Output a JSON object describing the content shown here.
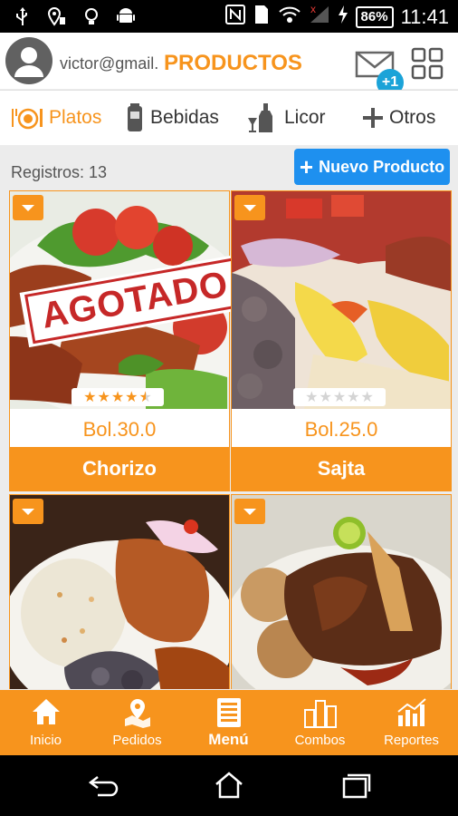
{
  "status_bar": {
    "battery": "86%",
    "time": "11:41",
    "left_icons": [
      "usb-icon",
      "location-icon",
      "bulb-icon",
      "android-icon"
    ],
    "right_icons": [
      "nfc-icon",
      "sim-icon",
      "wifi-icon",
      "signal-icon",
      "charging-icon"
    ]
  },
  "header": {
    "email": "victor@gmail.",
    "title": "PRODUCTOS",
    "mail_badge": "+1"
  },
  "tabs": [
    {
      "label": "Platos",
      "icon": "plate-icon",
      "active": true
    },
    {
      "label": "Bebidas",
      "icon": "can-icon",
      "active": false
    },
    {
      "label": "Licor",
      "icon": "bottle-icon",
      "active": false
    },
    {
      "label": "Otros",
      "icon": "plus-icon",
      "active": false
    }
  ],
  "list": {
    "records_text": "Registros: 13",
    "new_button": "Nuevo Producto"
  },
  "products": [
    {
      "name": "Chorizo",
      "price": "Bol.30.0",
      "rating": 4.5,
      "badge": "AGOTADO"
    },
    {
      "name": "Sajta",
      "price": "Bol.25.0",
      "rating": 0,
      "badge": ""
    },
    {
      "name": "",
      "price": "",
      "rating": null,
      "badge": ""
    },
    {
      "name": "",
      "price": "",
      "rating": null,
      "badge": ""
    }
  ],
  "bottom_nav": [
    {
      "label": "Inicio",
      "icon": "home-icon"
    },
    {
      "label": "Pedidos",
      "icon": "map-pin-icon"
    },
    {
      "label": "Menú",
      "icon": "menu-list-icon",
      "active": true
    },
    {
      "label": "Combos",
      "icon": "combos-icon"
    },
    {
      "label": "Reportes",
      "icon": "chart-icon"
    }
  ],
  "colors": {
    "accent": "#f7941d",
    "primary_button": "#1e90ef",
    "badge": "#1ba3d8",
    "sold_out": "#c62828"
  }
}
